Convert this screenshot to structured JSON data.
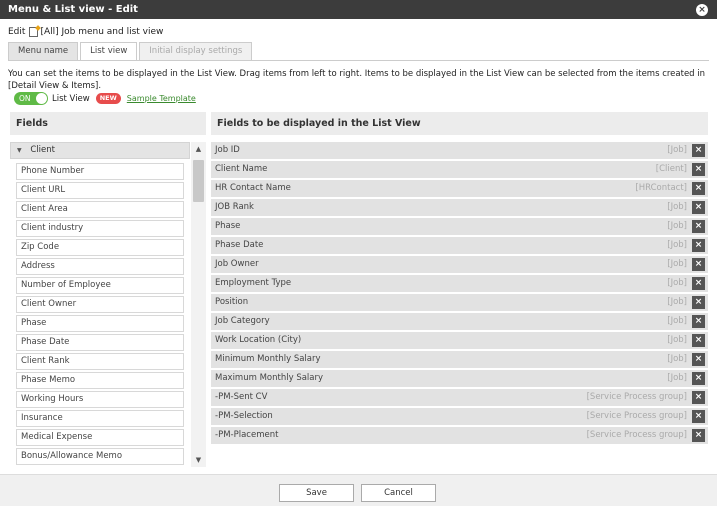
{
  "window": {
    "title": "Menu & List view - Edit"
  },
  "edit_line": {
    "prefix": "Edit",
    "target": "[All] Job menu and list view"
  },
  "tabs": [
    {
      "label": "Menu name",
      "state": "normal"
    },
    {
      "label": "List view",
      "state": "active"
    },
    {
      "label": "Initial display settings",
      "state": "disabled"
    }
  ],
  "description": "You can set the items to be displayed in the List View. Drag items from left to right. Items to be displayed in the List View can be selected from the items created in [Detail View & Items].",
  "toggle": {
    "state_label": "ON",
    "label": "List View",
    "badge": "NEW",
    "link": "Sample Template"
  },
  "left_panel": {
    "title": "Fields",
    "group": "Client",
    "items": [
      "Phone Number",
      "Client URL",
      "Client Area",
      "Client industry",
      "Zip Code",
      "Address",
      "Number of Employee",
      "Client Owner",
      "Phase",
      "Phase Date",
      "Client Rank",
      "Phase Memo",
      "Working Hours",
      "Insurance",
      "Medical Expense",
      "Bonus/Allowance Memo"
    ]
  },
  "right_panel": {
    "title": "Fields to be displayed in the List View",
    "rows": [
      {
        "label": "Job ID",
        "tag": "[Job]"
      },
      {
        "label": "Client Name",
        "tag": "[Client]"
      },
      {
        "label": "HR Contact Name",
        "tag": "[HRContact]"
      },
      {
        "label": "JOB Rank",
        "tag": "[Job]"
      },
      {
        "label": "Phase",
        "tag": "[Job]"
      },
      {
        "label": "Phase Date",
        "tag": "[Job]"
      },
      {
        "label": "Job Owner",
        "tag": "[Job]"
      },
      {
        "label": "Employment Type",
        "tag": "[Job]"
      },
      {
        "label": "Position",
        "tag": "[Job]"
      },
      {
        "label": "Job Category",
        "tag": "[Job]"
      },
      {
        "label": "Work Location (City)",
        "tag": "[Job]"
      },
      {
        "label": "Minimum Monthly Salary",
        "tag": "[Job]"
      },
      {
        "label": "Maximum Monthly Salary",
        "tag": "[Job]"
      },
      {
        "label": "-PM-Sent CV",
        "tag": "[Service Process group]"
      },
      {
        "label": "-PM-Selection",
        "tag": "[Service Process group]"
      },
      {
        "label": "-PM-Placement",
        "tag": "[Service Process group]"
      }
    ]
  },
  "footer": {
    "save_label": "Save",
    "cancel_label": "Cancel"
  },
  "icons": {
    "close": "×",
    "remove": "×",
    "caret_down": "▼",
    "caret_up": "▲",
    "group_caret": "▼"
  }
}
